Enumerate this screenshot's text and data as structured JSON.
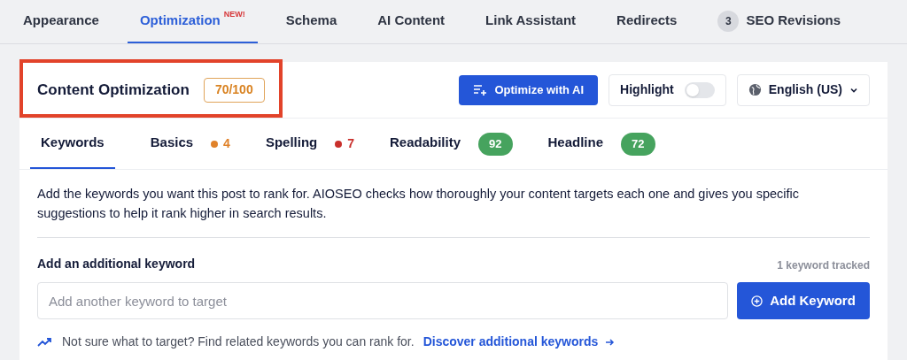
{
  "tabs": [
    {
      "label": "Appearance",
      "selected": false
    },
    {
      "label": "Optimization",
      "selected": true,
      "badge": "NEW!"
    },
    {
      "label": "Schema",
      "selected": false
    },
    {
      "label": "AI Content",
      "selected": false
    },
    {
      "label": "Link Assistant",
      "selected": false
    },
    {
      "label": "Redirects",
      "selected": false
    },
    {
      "label": "SEO Revisions",
      "selected": false,
      "count": "3"
    }
  ],
  "header": {
    "title": "Content Optimization",
    "score": "70/100",
    "highlighted": true,
    "optimize_button": "Optimize with AI",
    "highlight_toggle": {
      "label": "Highlight",
      "on": false
    },
    "language": "English (US)"
  },
  "subtabs": [
    {
      "label": "Keywords",
      "selected": true
    },
    {
      "label": "Basics",
      "selected": false,
      "kind": "dot",
      "count": "4",
      "color": "#e0822a"
    },
    {
      "label": "Spelling",
      "selected": false,
      "kind": "dot",
      "count": "7",
      "color": "#c9302c"
    },
    {
      "label": "Readability",
      "selected": false,
      "kind": "pill",
      "count": "92",
      "color": "#46a35e"
    },
    {
      "label": "Headline",
      "selected": false,
      "kind": "pill",
      "count": "72",
      "color": "#46a35e"
    }
  ],
  "description": "Add the keywords you want this post to rank for. AIOSEO checks how thoroughly your content targets each one and gives you specific suggestions to help it rank higher in search results.",
  "keyword": {
    "label": "Add an additional keyword",
    "tracked": "1 keyword tracked",
    "placeholder": "Add another keyword to target",
    "button": "Add Keyword"
  },
  "hint": {
    "text": "Not sure what to target? Find related keywords you can rank for.",
    "link": "Discover additional keywords"
  }
}
